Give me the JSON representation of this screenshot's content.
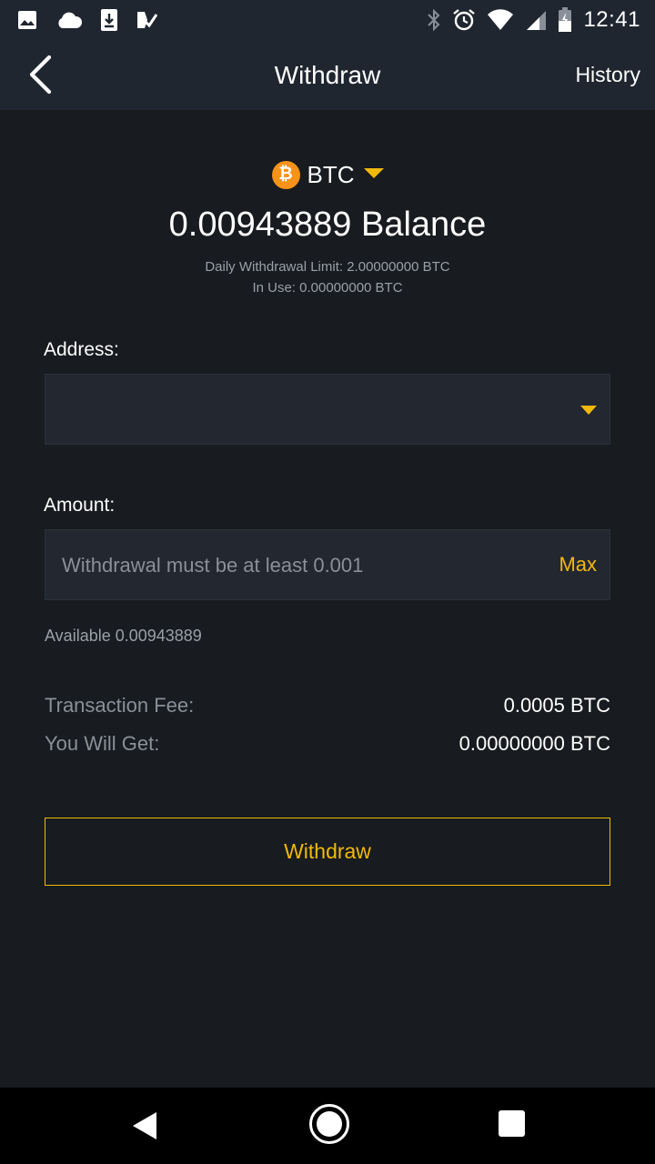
{
  "status_bar": {
    "time": "12:41",
    "left_icons": [
      "image-icon",
      "cloud-icon",
      "download-icon",
      "task-check-icon"
    ],
    "right_icons": [
      "bluetooth-icon",
      "alarm-icon",
      "wifi-icon",
      "signal-icon",
      "battery-icon"
    ]
  },
  "app_bar": {
    "title": "Withdraw",
    "history_label": "History"
  },
  "coin": {
    "symbol_glyph": "₿",
    "name": "BTC"
  },
  "balance": {
    "text": "0.00943889 Balance",
    "daily_limit": "Daily Withdrawal Limit: 2.00000000 BTC",
    "in_use": "In Use: 0.00000000 BTC"
  },
  "address": {
    "label": "Address:",
    "value": ""
  },
  "amount": {
    "label": "Amount:",
    "placeholder": "Withdrawal must be at least 0.001",
    "max_label": "Max",
    "available": "Available 0.00943889"
  },
  "summary": {
    "fee_label": "Transaction Fee:",
    "fee_value": "0.0005 BTC",
    "get_label": "You Will Get:",
    "get_value": "0.00000000 BTC"
  },
  "withdraw_button": "Withdraw",
  "colors": {
    "accent": "#f0b90b",
    "bitcoin": "#f7931a",
    "background": "#181b1f",
    "header": "#1f2630"
  }
}
